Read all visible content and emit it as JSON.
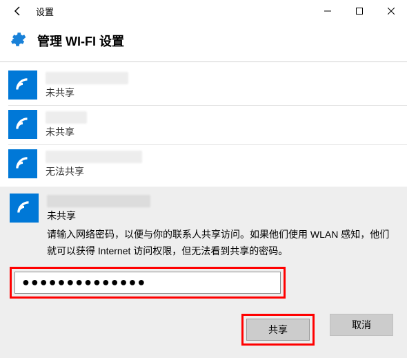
{
  "window": {
    "title": "设置"
  },
  "page": {
    "heading": "管理 WI-FI 设置"
  },
  "networks": [
    {
      "status": "未共享"
    },
    {
      "status": "未共享"
    },
    {
      "status": "无法共享"
    }
  ],
  "selected": {
    "status": "未共享",
    "description": "请输入网络密码，以便与你的联系人共享访问。如果他们使用 WLAN 感知，他们就可以获得 Internet 访问权限，但无法看到共享的密码。",
    "password_value": "●●●●●●●●●●●●●●",
    "share_label": "共享",
    "cancel_label": "取消"
  },
  "colors": {
    "accent": "#0078d7",
    "highlight": "#ff0000"
  }
}
